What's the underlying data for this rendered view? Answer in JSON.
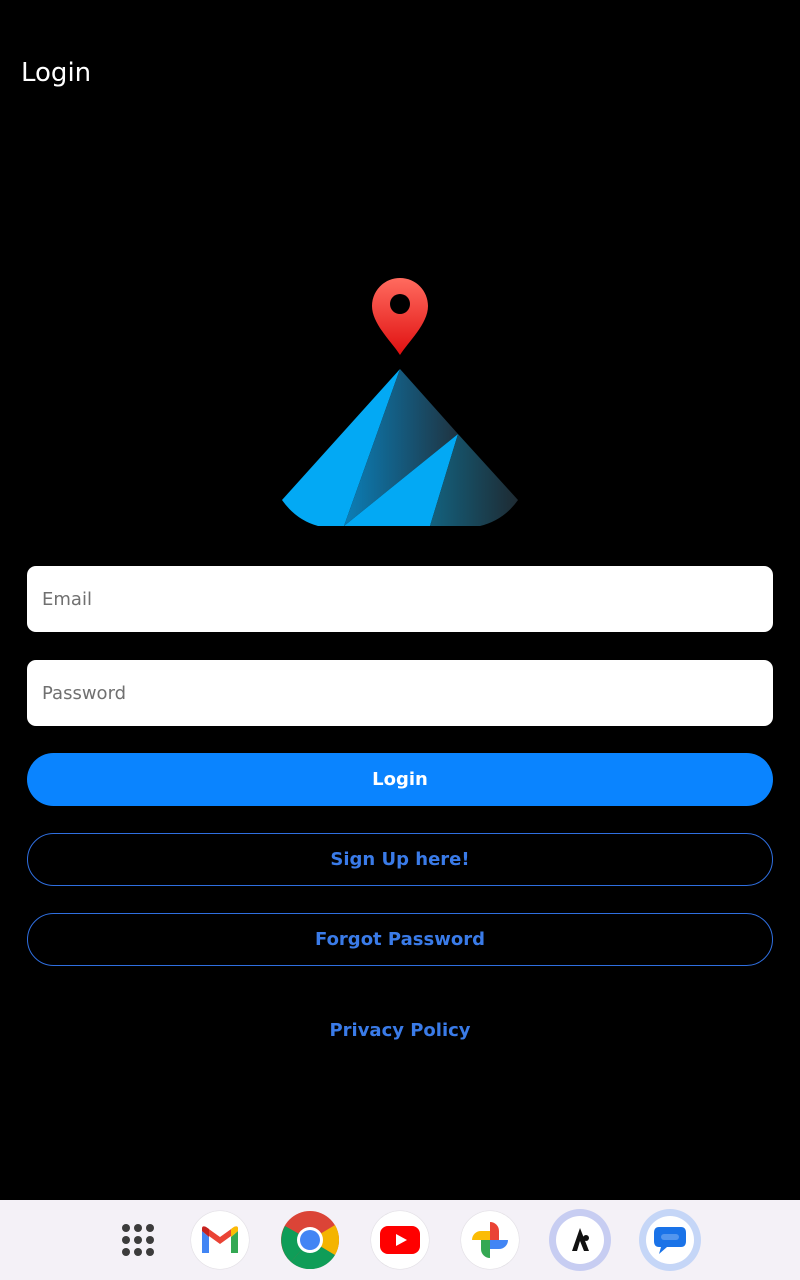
{
  "header": {
    "title": "Login"
  },
  "form": {
    "email": {
      "placeholder": "Email",
      "value": ""
    },
    "password": {
      "placeholder": "Password",
      "value": ""
    }
  },
  "buttons": {
    "login": "Login",
    "signup": "Sign Up here!",
    "forgot": "Forgot Password"
  },
  "links": {
    "privacy": "Privacy Policy"
  },
  "colors": {
    "background": "#000000",
    "primary": "#0A84FF",
    "link": "#3A7BE8",
    "logo_light": "#03A9F4",
    "logo_dark": "#1E2A32",
    "pin": "#E8302A"
  },
  "taskbar": {
    "apps": [
      {
        "icon": "app-drawer-icon"
      },
      {
        "icon": "gmail-icon"
      },
      {
        "icon": "chrome-icon"
      },
      {
        "icon": "youtube-icon"
      },
      {
        "icon": "photos-icon"
      },
      {
        "icon": "custom-app-icon"
      },
      {
        "icon": "messages-icon"
      }
    ]
  }
}
